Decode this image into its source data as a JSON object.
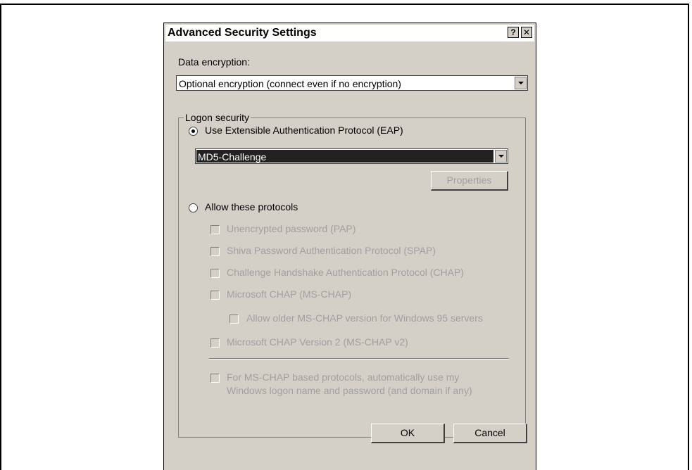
{
  "dialog": {
    "title": "Advanced Security Settings",
    "help_label": "?",
    "close_label": "✕"
  },
  "data_encryption": {
    "label": "Data encryption:",
    "selected": "Optional encryption (connect even if no encryption)"
  },
  "logon_security": {
    "group_title": "Logon security",
    "eap_radio_label": "Use Extensible Authentication Protocol (EAP)",
    "eap_selected": "MD5-Challenge",
    "properties_label": "Properties",
    "allow_radio_label": "Allow these protocols",
    "protocols": [
      {
        "label": "Unencrypted password (PAP)"
      },
      {
        "label": "Shiva Password Authentication Protocol (SPAP)"
      },
      {
        "label": "Challenge Handshake Authentication Protocol (CHAP)"
      },
      {
        "label": "Microsoft CHAP (MS-CHAP)"
      },
      {
        "label": "Allow older MS-CHAP version for Windows 95 servers"
      },
      {
        "label": "Microsoft CHAP Version 2 (MS-CHAP v2)"
      }
    ],
    "auto_logon_line1": "For MS-CHAP based protocols, automatically use my",
    "auto_logon_line2": "Windows logon name and password (and domain if any)"
  },
  "buttons": {
    "ok_label": "OK",
    "cancel_label": "Cancel"
  },
  "state": {
    "eap_checked": true,
    "allow_checked": false,
    "protocols_checked": [
      false,
      false,
      false,
      false,
      false,
      false
    ],
    "auto_logon_checked": false
  }
}
